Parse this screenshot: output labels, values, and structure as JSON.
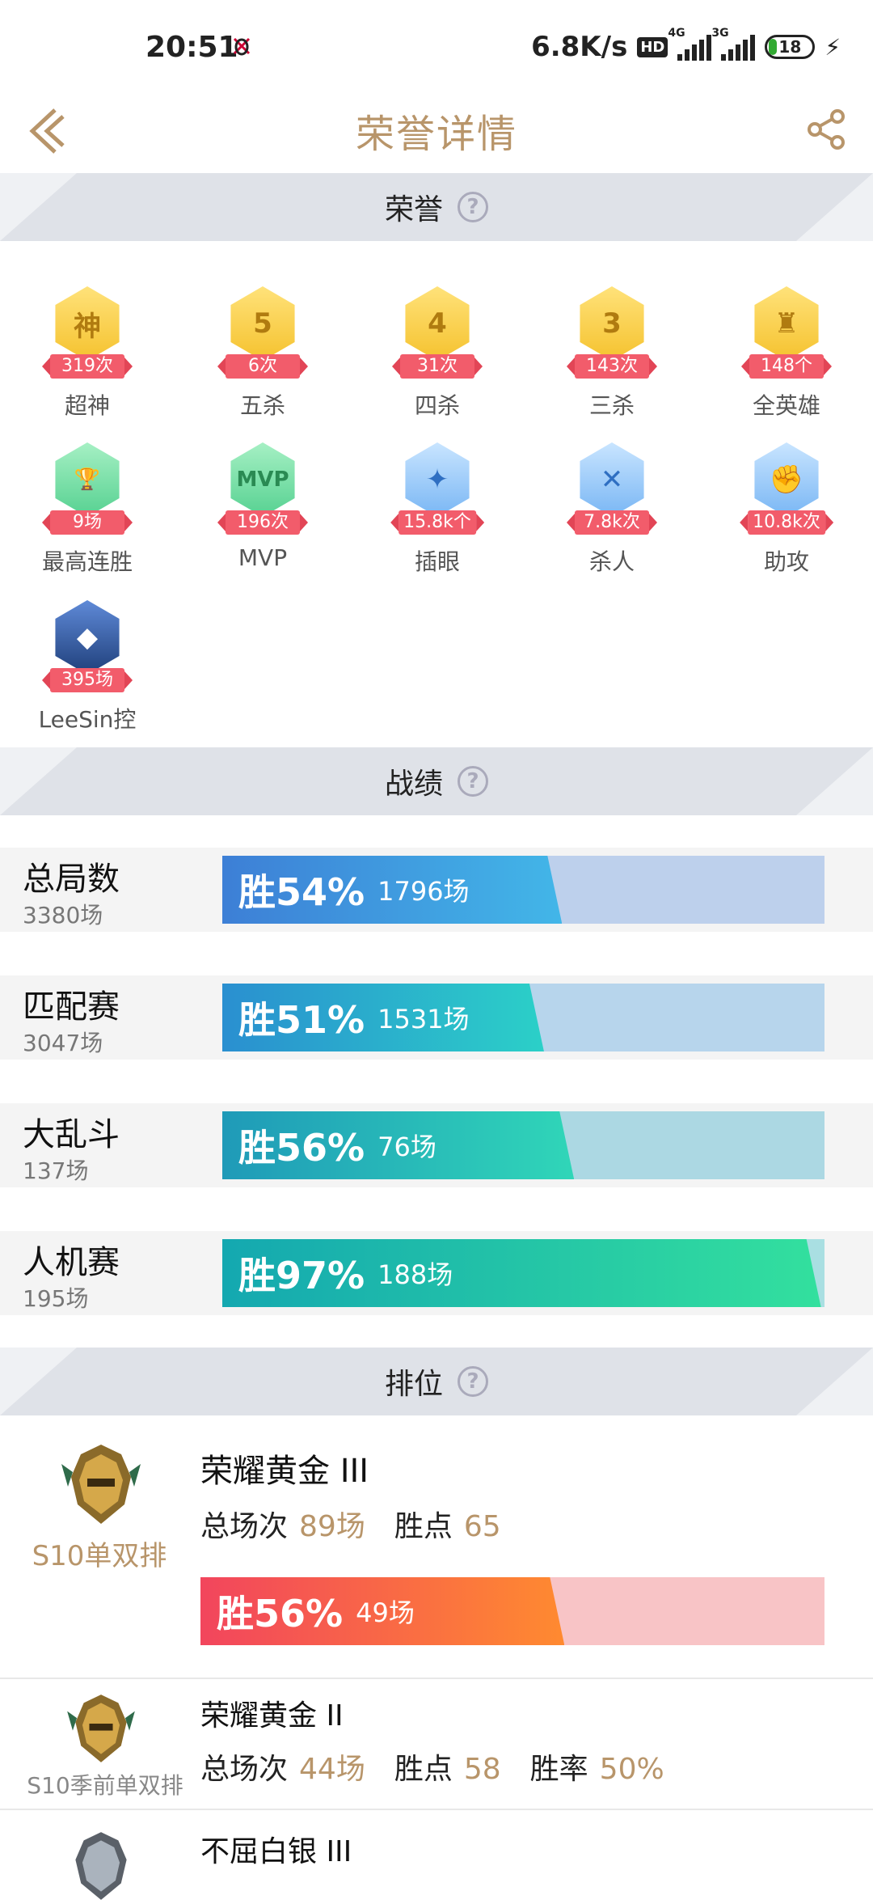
{
  "status_bar": {
    "time": "20:51",
    "net_speed": "6.8K/s",
    "hd": "HD",
    "sig1_tag": "4G",
    "sig2_tag": "3G",
    "battery": "18"
  },
  "nav": {
    "title": "荣誉详情",
    "back_icon": "back-chevron-icon",
    "share_icon": "share-icon"
  },
  "honors_section": {
    "title": "荣誉",
    "items": [
      {
        "glyph": "神",
        "count": "319次",
        "label": "超神",
        "style": "gold"
      },
      {
        "glyph": "5",
        "count": "6次",
        "label": "五杀",
        "style": "gold"
      },
      {
        "glyph": "4",
        "count": "31次",
        "label": "四杀",
        "style": "gold"
      },
      {
        "glyph": "3",
        "count": "143次",
        "label": "三杀",
        "style": "gold"
      },
      {
        "glyph": "♜",
        "count": "148个",
        "label": "全英雄",
        "style": "gold"
      },
      {
        "glyph": "🏆",
        "count": "9场",
        "label": "最高连胜",
        "style": "green"
      },
      {
        "glyph": "MVP",
        "count": "196次",
        "label": "MVP",
        "style": "green"
      },
      {
        "glyph": "✦",
        "count": "15.8k个",
        "label": "插眼",
        "style": "blue"
      },
      {
        "glyph": "✕",
        "count": "7.8k次",
        "label": "杀人",
        "style": "blue"
      },
      {
        "glyph": "✊",
        "count": "10.8k次",
        "label": "助攻",
        "style": "blue"
      },
      {
        "glyph": "◆",
        "count": "395场",
        "label": "LeeSin控",
        "style": "dark"
      }
    ]
  },
  "record_section": {
    "title": "战绩",
    "rows": [
      {
        "name": "总局数",
        "total": "3380场",
        "win_label": "胜54%",
        "win_pct": 54,
        "wins": "1796场",
        "fill": "linear-gradient(90deg,#3d7fd6,#42b6e8)",
        "bg": "#bdd0ec"
      },
      {
        "name": "匹配赛",
        "total": "3047场",
        "win_label": "胜51%",
        "win_pct": 51,
        "wins": "1531场",
        "fill": "linear-gradient(90deg,#2a8fd0,#2bd0c8)",
        "bg": "#b7d5ec"
      },
      {
        "name": "大乱斗",
        "total": "137场",
        "win_label": "胜56%",
        "win_pct": 56,
        "wins": "76场",
        "fill": "linear-gradient(90deg,#1f9ab8,#30d6b8)",
        "bg": "#acd8e3"
      },
      {
        "name": "人机赛",
        "total": "195场",
        "win_label": "胜97%",
        "win_pct": 97,
        "wins": "188场",
        "fill": "linear-gradient(90deg,#14a8b0,#33e09e)",
        "bg": "#a9dfe2"
      }
    ]
  },
  "rank_section": {
    "title": "排位",
    "entries": [
      {
        "season": "S10单双排",
        "tier": "荣耀黄金 III",
        "games_label": "总场次",
        "games": "89场",
        "points_label": "胜点",
        "points": "65",
        "win_label": "胜56%",
        "win_pct": 56,
        "wins": "49场"
      },
      {
        "season": "S10季前单双排",
        "tier": "荣耀黄金 II",
        "games_label": "总场次",
        "games": "44场",
        "points_label": "胜点",
        "points": "58",
        "rate_label": "胜率",
        "rate": "50%"
      },
      {
        "tier": "不屈白银 III"
      }
    ]
  }
}
